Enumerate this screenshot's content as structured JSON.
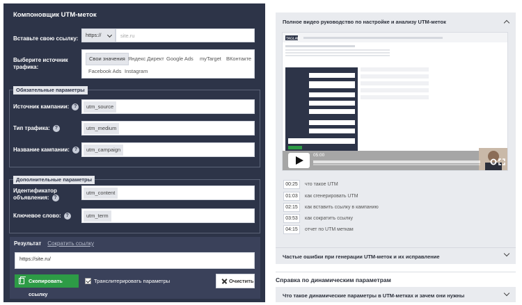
{
  "builder": {
    "title": "Компоновщик UTM-меток",
    "link_label": "Вставьте свою ссылку:",
    "protocol": "https://",
    "link_placeholder": "site.ru",
    "source_label": "Выберите источник трафика:",
    "sources": [
      "Свои значения",
      "Яндекс Директ",
      "Google Ads",
      "myTarget",
      "ВКонтакте",
      "Facebook Ads",
      "Instagram"
    ],
    "selected_source": "Свои значения",
    "required_group": "Обязательные параметры",
    "optional_group": "Дополнительные параметры",
    "fields": {
      "campaign_source": {
        "label": "Источник кампании:",
        "tag": "utm_source"
      },
      "traffic_type": {
        "label": "Тип трафика:",
        "tag": "utm_medium"
      },
      "campaign_name": {
        "label": "Название кампании:",
        "tag": "utm_campaign"
      },
      "ad_id": {
        "label": "Идентификатор объявления:",
        "tag": "utm_content"
      },
      "keyword": {
        "label": "Ключевое слово:",
        "tag": "utm_term"
      }
    },
    "help_icon": "?"
  },
  "result": {
    "tab_result": "Результат",
    "tab_shorten": "Сократить ссылку",
    "value": "https://site.ru/",
    "copy_button": "Скопировать ссылку",
    "transliterate_label": "Транслитерировать параметры",
    "transliterate_checked": true,
    "clear_button": "Очистить",
    "copy_color": "#2d9b46"
  },
  "video_section": {
    "title": "Полное видео руководство по настройке и анализу UTM-меток",
    "current_time": "05:00",
    "timestamps": [
      {
        "time": "00:25",
        "text": "что такое UTM"
      },
      {
        "time": "01:03",
        "text": "как сгенерировать UTM"
      },
      {
        "time": "02:15",
        "text": "как вставить ссылку в кампанию"
      },
      {
        "time": "03:53",
        "text": "как сократить ссылку"
      },
      {
        "time": "04:15",
        "text": "отчет по UTM меткам"
      }
    ],
    "video_logo": "TAGLAB"
  },
  "faq": {
    "errors_title": "Частые ошибки при генерации UTM-меток и их исправление",
    "dynamic_heading": "Справка по динамическим параметрам",
    "dynamic_item": "Что такое динамические параметры в UTM-метках и зачем они нужны"
  },
  "colors": {
    "panel_bg": "#2d3448",
    "accordion_bg": "#e9ebef"
  }
}
